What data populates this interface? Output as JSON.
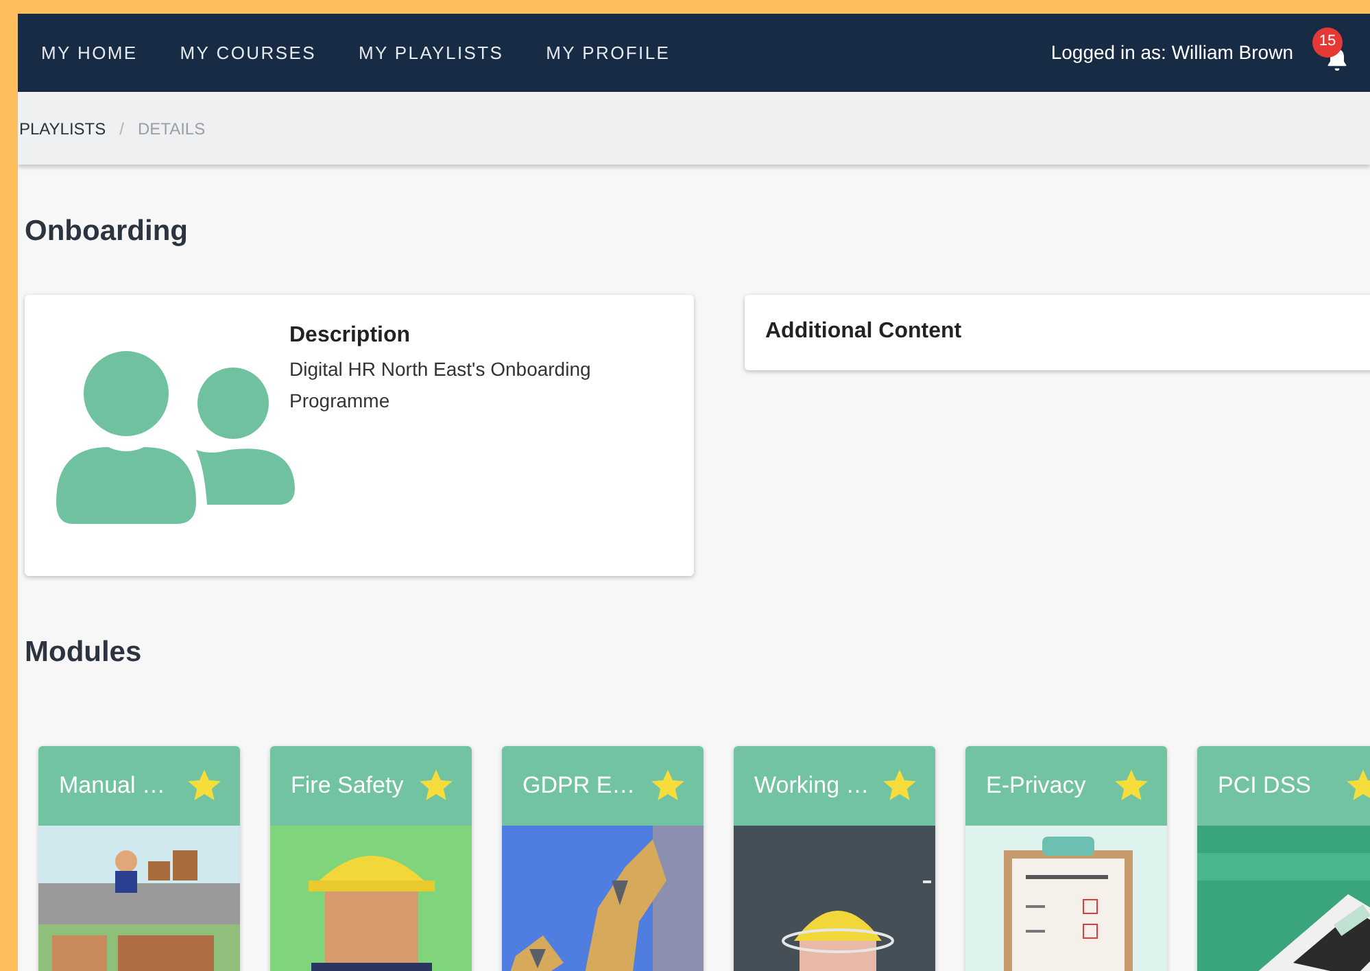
{
  "nav": {
    "items": [
      {
        "label": "MY HOME",
        "selected": false
      },
      {
        "label": "MY COURSES",
        "selected": false
      },
      {
        "label": "MY PLAYLISTS",
        "selected": false
      },
      {
        "label": "MY PROFILE",
        "selected": false
      }
    ],
    "user": "Logged in as: William Brown",
    "notifications": "15"
  },
  "breadcrumb": {
    "separator": "/",
    "items": [
      {
        "label": "PLAYLISTS",
        "selected": false
      },
      {
        "label": "DETAILS",
        "selected": true
      }
    ]
  },
  "title": "Onboarding",
  "description": {
    "heading": "Description",
    "text": "Digital HR North East's Onboarding Programme"
  },
  "additional": {
    "heading": "Additional Content"
  },
  "modules_title": "Modules",
  "modules": [
    {
      "title": "Manual …",
      "favorite": true
    },
    {
      "title": "Fire Safety",
      "favorite": true
    },
    {
      "title": "GDPR E…",
      "favorite": true
    },
    {
      "title": "Working …",
      "favorite": true
    },
    {
      "title": "E-Privacy",
      "favorite": true
    },
    {
      "title": "PCI DSS",
      "favorite": true
    }
  ]
}
